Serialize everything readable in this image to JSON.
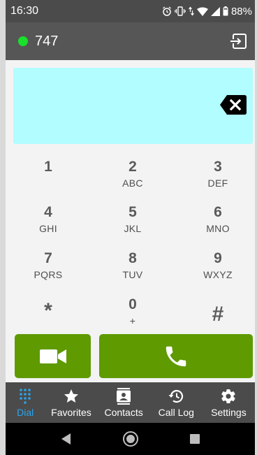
{
  "status_bar": {
    "time": "16:30",
    "icons": [
      "alarm-icon",
      "vibrate-icon",
      "data-arrows-icon",
      "wifi-icon",
      "signal-icon",
      "battery-icon"
    ],
    "battery_percent": "88%"
  },
  "app_bar": {
    "account": "747",
    "presence_color": "#19e02a",
    "logout_icon": "logout-icon"
  },
  "dial_display": {
    "value": "",
    "background": "#b2fdff",
    "backspace_icon": "backspace-icon"
  },
  "keypad": {
    "keys": [
      {
        "digit": "1",
        "letters": ""
      },
      {
        "digit": "2",
        "letters": "ABC"
      },
      {
        "digit": "3",
        "letters": "DEF"
      },
      {
        "digit": "4",
        "letters": "GHI"
      },
      {
        "digit": "5",
        "letters": "JKL"
      },
      {
        "digit": "6",
        "letters": "MNO"
      },
      {
        "digit": "7",
        "letters": "PQRS"
      },
      {
        "digit": "8",
        "letters": "TUV"
      },
      {
        "digit": "9",
        "letters": "WXYZ"
      },
      {
        "digit": "*",
        "letters": ""
      },
      {
        "digit": "0",
        "letters": "+"
      },
      {
        "digit": "#",
        "letters": ""
      }
    ]
  },
  "actions": {
    "video_call_icon": "video-camera-icon",
    "voice_call_icon": "phone-icon",
    "button_color": "#5e9a00"
  },
  "bottom_nav": {
    "active_color": "#2aa5ec",
    "items": [
      {
        "label": "Dial",
        "icon": "dialpad-icon",
        "active": true
      },
      {
        "label": "Favorites",
        "icon": "star-icon",
        "active": false
      },
      {
        "label": "Contacts",
        "icon": "contacts-icon",
        "active": false
      },
      {
        "label": "Call Log",
        "icon": "history-icon",
        "active": false
      },
      {
        "label": "Settings",
        "icon": "gear-icon",
        "active": false
      }
    ]
  },
  "system_nav": {
    "buttons": [
      "back-icon",
      "home-icon",
      "recents-icon"
    ]
  }
}
